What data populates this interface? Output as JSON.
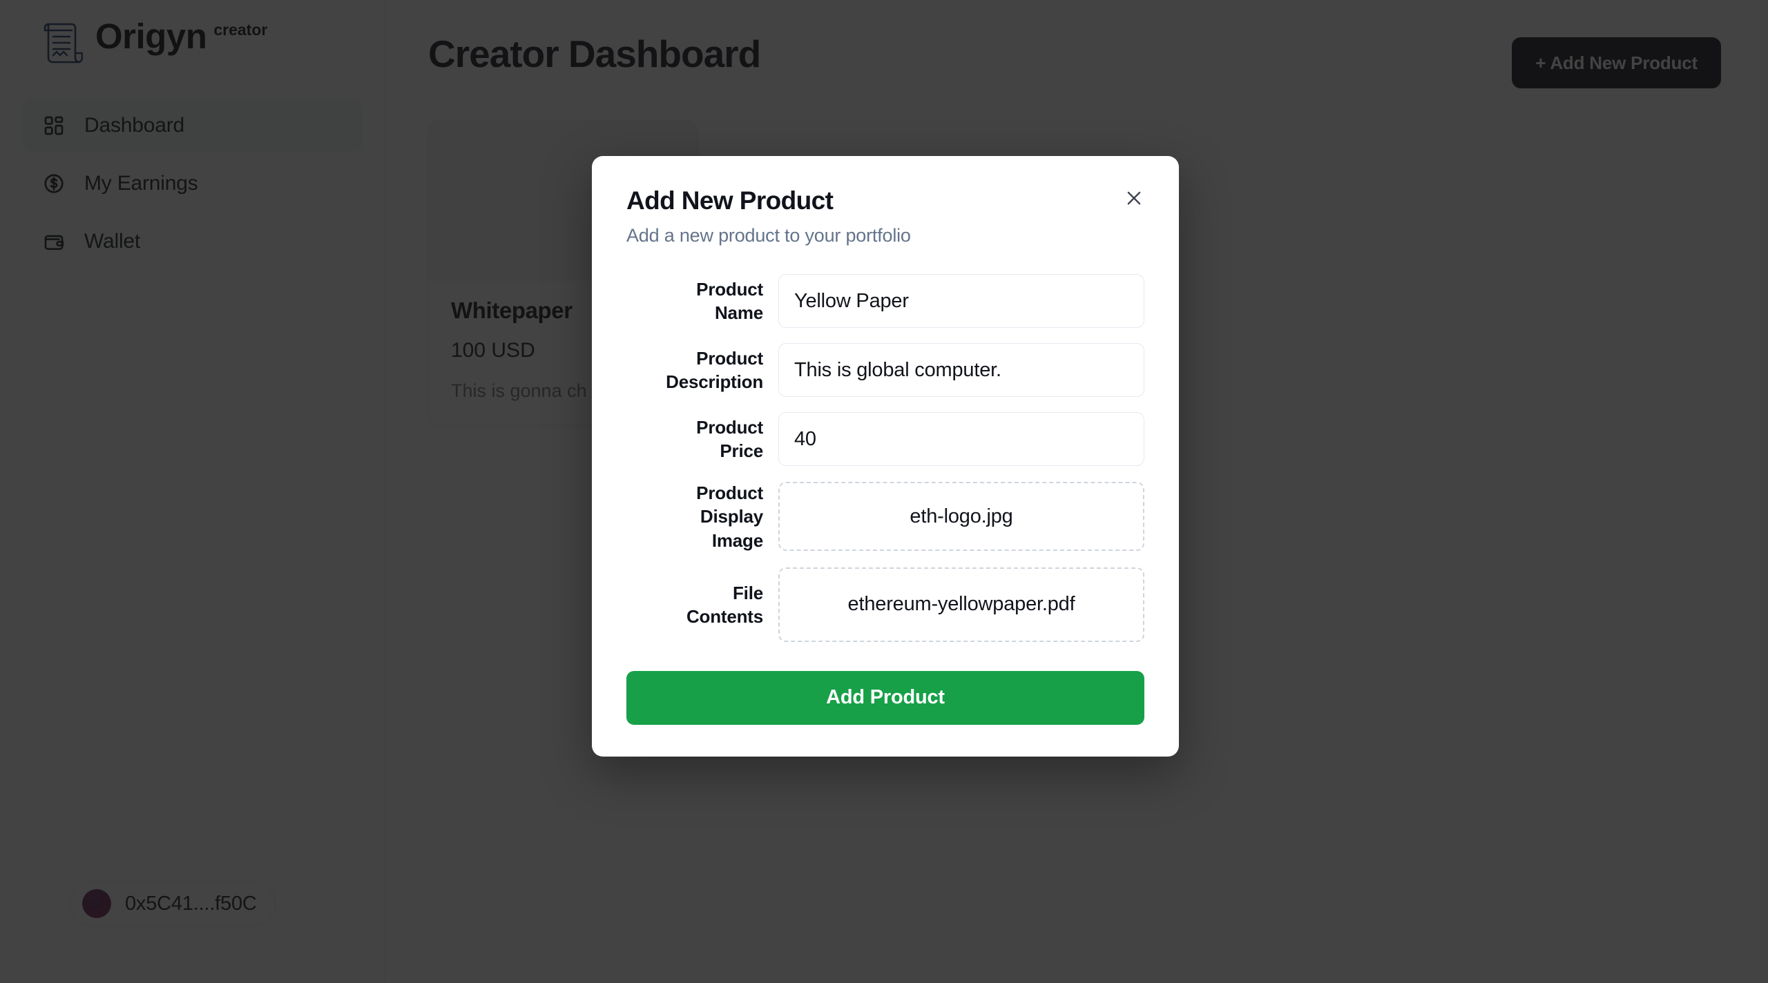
{
  "brand": {
    "name": "Origyn",
    "superscript": "creator",
    "logo_icon": "scroll-document-icon",
    "logo_color": "#1b3a68"
  },
  "sidebar": {
    "items": [
      {
        "label": "Dashboard",
        "icon": "grid-dashboard-icon",
        "active": true
      },
      {
        "label": "My Earnings",
        "icon": "dollar-circle-icon",
        "active": false
      },
      {
        "label": "Wallet",
        "icon": "wallet-icon",
        "active": false
      }
    ],
    "wallet": {
      "address": "0x5C41....f50C",
      "avatar_icon": "wallet-avatar-gradient"
    }
  },
  "main": {
    "page_title": "Creator Dashboard",
    "add_product_button": "+ Add New Product",
    "products": [
      {
        "name": "Whitepaper",
        "price": "100 USD",
        "description": "This is gonna ch"
      }
    ]
  },
  "modal": {
    "title": "Add New Product",
    "subtitle": "Add a new product to your portfolio",
    "close_icon": "close-x-icon",
    "fields": [
      {
        "label": "Product\nName",
        "value": "Yellow Paper",
        "placeholder": "Product Name",
        "type": "text"
      },
      {
        "label": "Product\nDescription",
        "value": "This is global computer.",
        "placeholder": "Product Description",
        "type": "text"
      },
      {
        "label": "Product\nPrice",
        "value": "40",
        "placeholder": "Product Price",
        "type": "text"
      },
      {
        "label": "Product\nDisplay\nImage",
        "value": "eth-logo.jpg",
        "placeholder": "",
        "type": "dropzone"
      },
      {
        "label": "File\nContents",
        "value": "ethereum-yellowpaper.pdf",
        "placeholder": "",
        "type": "dropzone"
      }
    ],
    "submit_label": "Add Product",
    "submit_color": "#17a048"
  }
}
